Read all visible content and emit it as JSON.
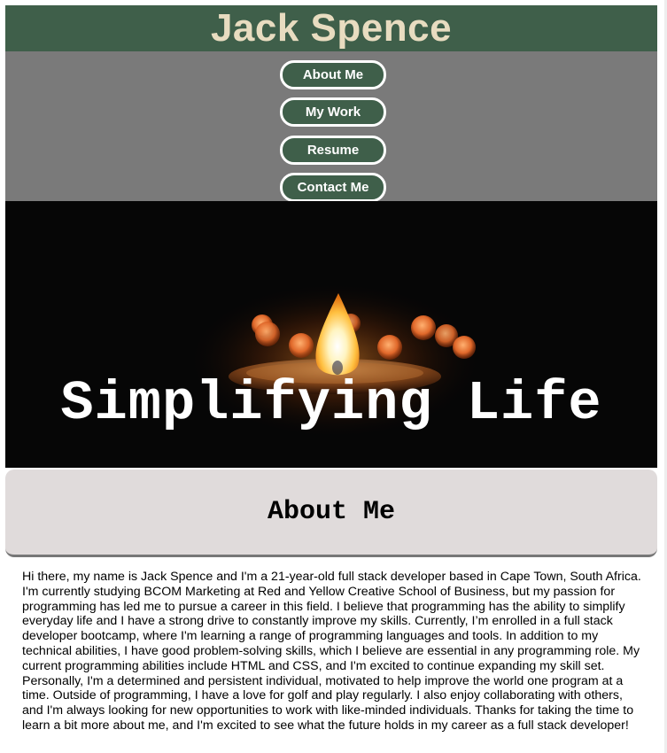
{
  "header": {
    "title": "Jack Spence",
    "background_color": "#3f5f4a",
    "title_color": "#e8dcc0"
  },
  "nav": {
    "background_color": "#7a7a7a",
    "items": [
      {
        "label": "About Me"
      },
      {
        "label": "My Work"
      },
      {
        "label": "Resume"
      },
      {
        "label": "Contact Me"
      }
    ]
  },
  "hero": {
    "title": "Simplifying Life",
    "image_subject": "candle-flame-with-bokeh-lights"
  },
  "about": {
    "heading": "About Me",
    "body": "Hi there, my name is Jack Spence and I'm a 21-year-old full stack developer based in Cape Town, South Africa. I'm currently studying BCOM Marketing at Red and Yellow Creative School of Business, but my passion for programming has led me to pursue a career in this field. I believe that programming has the ability to simplify everyday life and I have a strong drive to constantly improve my skills. Currently, I’m enrolled in a full stack developer bootcamp, where I'm learning a range of programming languages and tools. In addition to my technical abilities, I have good problem-solving skills, which I believe are essential in any programming role. My current programming abilities include HTML and CSS, and I'm excited to continue expanding my skill set. Personally, I'm a determined and persistent individual, motivated to help improve the world one program at a time. Outside of programming, I have a love for golf and play regularly. I also enjoy collaborating with others, and I'm always looking for new opportunities to work with like-minded individuals. Thanks for taking the time to learn a bit more about me, and I'm excited to see what the future holds in my career as a full stack developer!"
  }
}
